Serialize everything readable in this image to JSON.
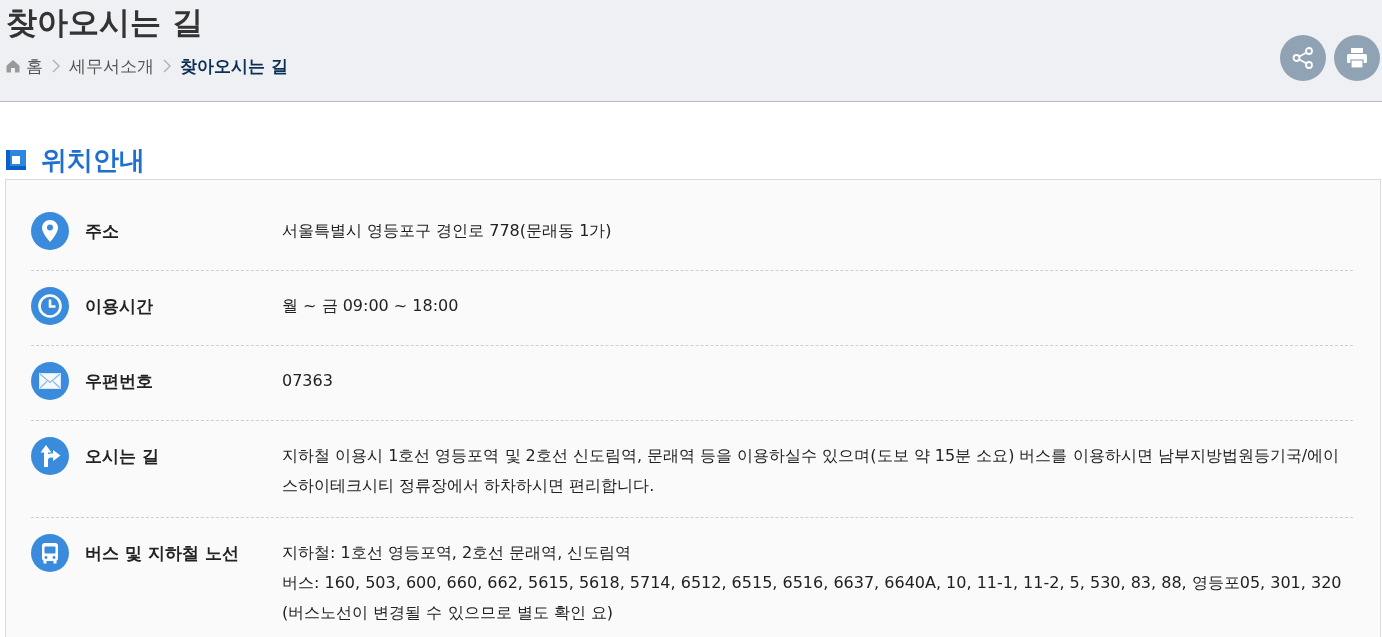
{
  "page": {
    "title": "찾아오시는 길"
  },
  "breadcrumb": [
    {
      "label": "홈",
      "kind": "home",
      "current": false
    },
    {
      "label": "세무서소개",
      "kind": "page",
      "current": false
    },
    {
      "label": "찾아오시는 길",
      "kind": "page",
      "current": true
    }
  ],
  "actions": [
    {
      "kind": "share"
    },
    {
      "kind": "print"
    }
  ],
  "section": {
    "heading": "위치안내",
    "rows": [
      {
        "kind": "location",
        "label": "주소",
        "lines": [
          "서울특별시 영등포구 경인로 778(문래동 1가)"
        ]
      },
      {
        "kind": "clock",
        "label": "이용시간",
        "lines": [
          "월 ~ 금 09:00 ~ 18:00"
        ]
      },
      {
        "kind": "mail",
        "label": "우편번호",
        "lines": [
          "07363"
        ]
      },
      {
        "kind": "directions",
        "label": "오시는 길",
        "lines": [
          "지하철 이용시 1호선 영등포역 및 2호선 신도림역, 문래역 등을 이용하실수 있으며(도보 약 15분 소요) 버스를 이용하시면 남부지방법원등기국/에이스하이테크시티 정류장에서 하차하시면 편리합니다."
        ]
      },
      {
        "kind": "bus",
        "label": "버스 및 지하철 노선",
        "lines": [
          "지하철: 1호선 영등포역, 2호선 문래역, 신도림역",
          "버스: 160, 503, 600, 660, 662, 5615, 5618, 5714, 6512, 6515, 6516, 6637, 6640A, 10, 11-1, 11-2, 5, 530, 83, 88, 영등포05, 301, 320",
          "(버스노선이 변경될 수 있으므로 별도 확인 요)"
        ]
      }
    ]
  }
}
